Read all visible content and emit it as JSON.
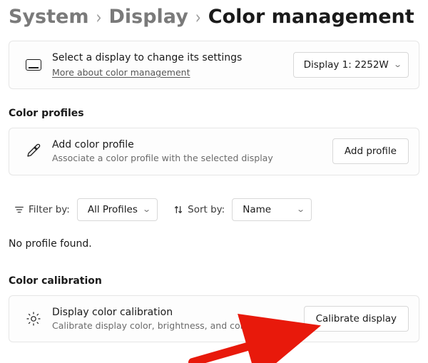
{
  "breadcrumb": {
    "system": "System",
    "display": "Display",
    "current": "Color management"
  },
  "displayCard": {
    "title": "Select a display to change its settings",
    "link": "More about color management",
    "selector": "Display 1: 2252W"
  },
  "sections": {
    "colorProfiles": "Color profiles",
    "colorCalibration": "Color calibration"
  },
  "addProfileCard": {
    "title": "Add color profile",
    "sub": "Associate a color profile with the selected display",
    "button": "Add profile"
  },
  "filterRow": {
    "filterLabel": "Filter by:",
    "filterValue": "All Profiles",
    "sortLabel": "Sort by:",
    "sortValue": "Name"
  },
  "emptyMessage": "No profile found.",
  "calibrationCard": {
    "title": "Display color calibration",
    "sub": "Calibrate display color, brightness, and contrast",
    "button": "Calibrate display"
  }
}
